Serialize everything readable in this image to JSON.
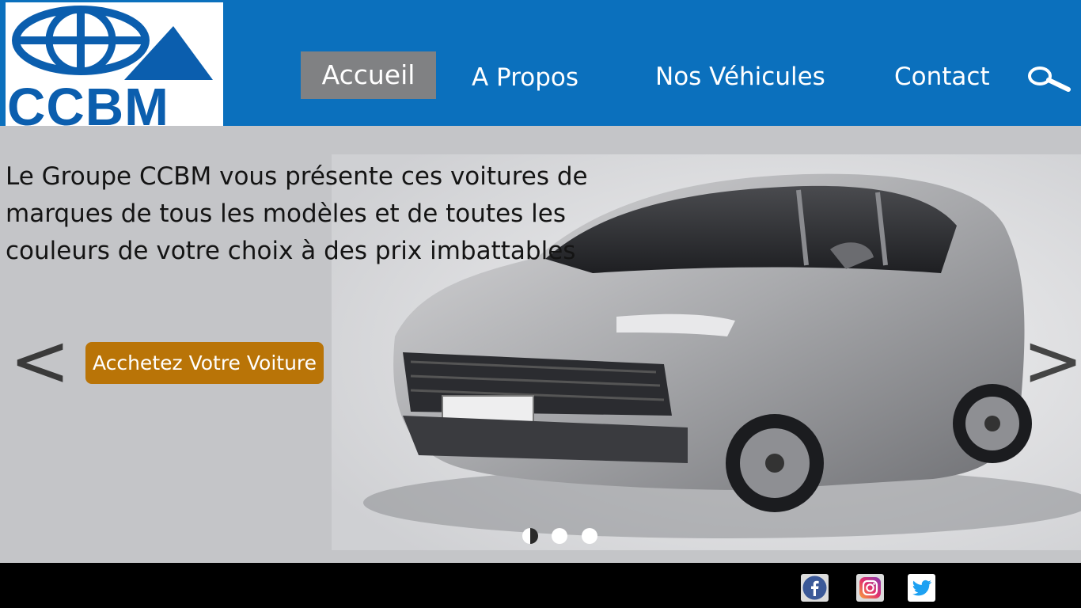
{
  "brand": {
    "logo_text": "CCBM",
    "primary_color": "#0b70bd",
    "logo_color": "#0b5eae"
  },
  "nav": {
    "items": [
      {
        "label": "Accueil",
        "active": true
      },
      {
        "label": "A Propos",
        "active": false
      },
      {
        "label": "Nos Véhicules",
        "active": false
      },
      {
        "label": "Contact",
        "active": false
      }
    ],
    "search_icon": "search-icon"
  },
  "hero": {
    "headline": "Le Groupe CCBM vous présente ces voitures de marques de tous les modèles et de toutes les couleurs de votre choix à des prix imbattables",
    "cta_label": "Acchetez Votre Voiture",
    "cta_color": "#b97407",
    "prev_label": "<",
    "next_label": ">",
    "slide_count": 3,
    "active_slide": 1
  },
  "footer": {
    "social": [
      {
        "icon": "facebook-icon",
        "color": "#3b5998"
      },
      {
        "icon": "instagram-icon",
        "color": "#c13584"
      },
      {
        "icon": "twitter-icon",
        "color": "#1da1f2"
      }
    ]
  }
}
